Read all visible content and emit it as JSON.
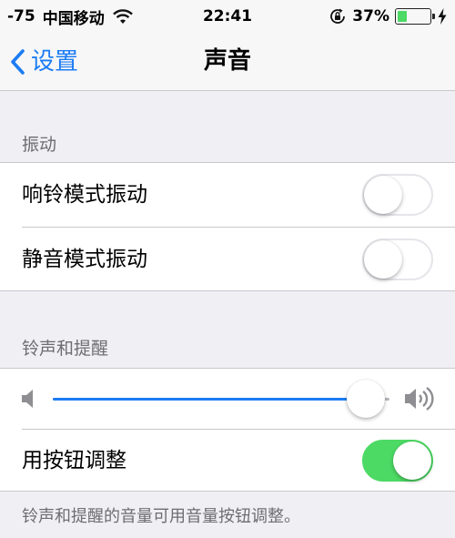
{
  "status_bar": {
    "signal": "-75",
    "carrier": "中国移动",
    "time": "22:41",
    "battery_percent": "37%",
    "battery_level": 0.37
  },
  "nav": {
    "back_label": "设置",
    "title": "声音"
  },
  "vibrate_section": {
    "header": "振动",
    "rows": [
      {
        "label": "响铃模式振动",
        "toggle_on": false
      },
      {
        "label": "静音模式振动",
        "toggle_on": false
      }
    ]
  },
  "ringer_section": {
    "header": "铃声和提醒",
    "volume_level": 0.93,
    "button_row": {
      "label": "用按钮调整",
      "toggle_on": true
    },
    "footer": "铃声和提醒的音量可用音量按钮调整。"
  },
  "colors": {
    "accent": "#1c7cf4",
    "toggle_on": "#4cd964",
    "background": "#efeff4"
  },
  "icons": [
    "wifi-icon",
    "rotation-lock-icon",
    "battery-icon",
    "charging-icon",
    "back-chevron-icon",
    "volume-low-icon",
    "volume-high-icon"
  ]
}
